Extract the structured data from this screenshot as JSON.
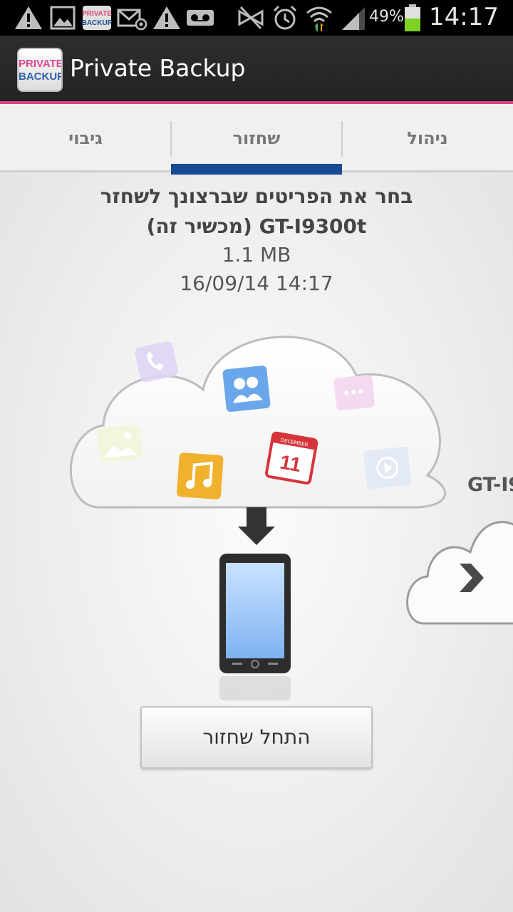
{
  "status_bar": {
    "battery_percent": "49%",
    "time": "14:17",
    "icons": [
      "warning-icon",
      "image-icon",
      "private-backup-icon",
      "email-icon",
      "warning-icon",
      "voicemail-icon",
      "mute-icon",
      "alarm-icon",
      "wifi-icon",
      "signal-icon",
      "battery-icon"
    ]
  },
  "app_bar": {
    "title": "Private Backup",
    "logo_line1": "PRIVATE",
    "logo_line2": "BACKUP"
  },
  "tabs": [
    {
      "label": "גיבוי",
      "active": false
    },
    {
      "label": "שחזור",
      "active": true
    },
    {
      "label": "ניהול",
      "active": false
    }
  ],
  "restore": {
    "instruction": "בחר את הפריטים שברצונך לשחזר",
    "device_line": "GT-I9300t (מכשיר זה)",
    "size": "1.1 MB",
    "date": "16/09/14 14:17",
    "calendar_month": "DECEMBER",
    "calendar_day": "11",
    "device_label_partial": "GT-I9",
    "start_button": "התחל שחזור"
  },
  "colors": {
    "accent_pink": "#d9457f",
    "tab_indicator": "#174a92",
    "battery_green": "#7dd321"
  }
}
